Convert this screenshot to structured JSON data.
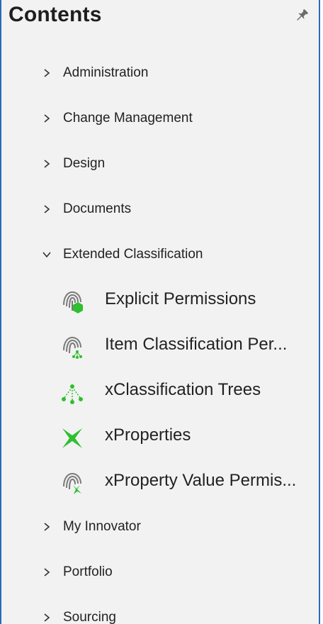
{
  "panel": {
    "title": "Contents",
    "pin_icon": "pin-icon"
  },
  "tree": {
    "top_items": [
      {
        "label": "Administration",
        "expanded": false
      },
      {
        "label": "Change Management",
        "expanded": false
      },
      {
        "label": "Design",
        "expanded": false
      },
      {
        "label": "Documents",
        "expanded": false
      },
      {
        "label": "Extended Classification",
        "expanded": true
      }
    ],
    "children": [
      {
        "label": "Explicit Permissions",
        "icon": "fingerprint-hexagon-icon"
      },
      {
        "label": "Item Classification Per...",
        "icon": "fingerprint-tree-icon"
      },
      {
        "label": "xClassification Trees",
        "icon": "tree-icon"
      },
      {
        "label": "xProperties",
        "icon": "star-x-icon"
      },
      {
        "label": "xProperty Value Permis...",
        "icon": "fingerprint-x-icon"
      }
    ],
    "bottom_items": [
      {
        "label": "My Innovator",
        "expanded": false
      },
      {
        "label": "Portfolio",
        "expanded": false
      },
      {
        "label": "Sourcing",
        "expanded": false
      }
    ]
  },
  "colors": {
    "border": "#2b6bb5",
    "panel_bg": "#f2f2f2",
    "accent_green": "#2fbf2f",
    "icon_gray": "#7a7a7a"
  }
}
